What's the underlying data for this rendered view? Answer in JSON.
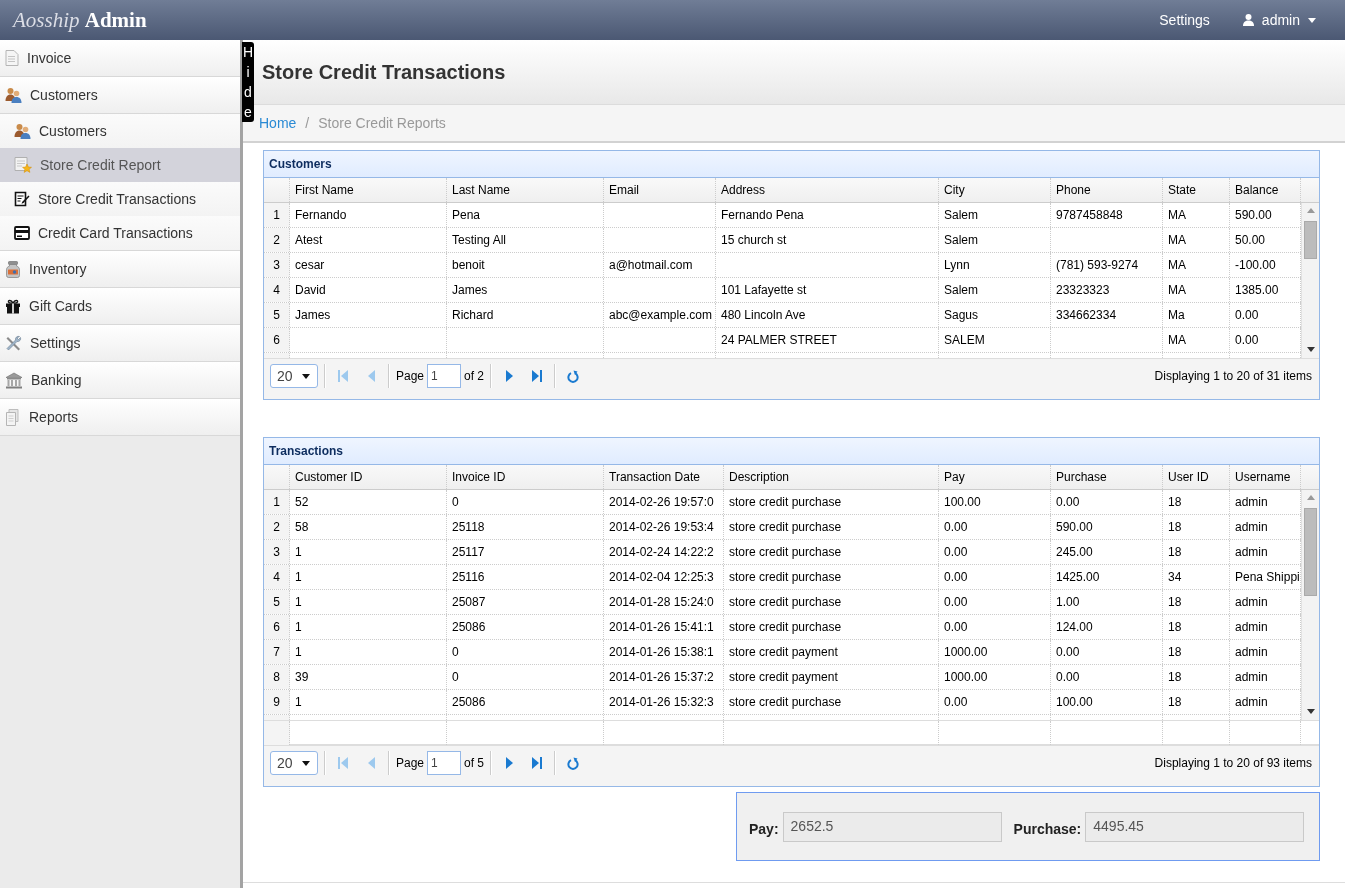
{
  "topbar": {
    "brand": {
      "primary": "Aosship",
      "secondary": "Admin"
    },
    "settings_link": "Settings",
    "user_menu": "admin"
  },
  "sidebar": {
    "items": [
      {
        "label": "Invoice",
        "selected": false
      },
      {
        "label": "Customers",
        "selected": false,
        "children": [
          {
            "label": "Customers",
            "selected": false
          },
          {
            "label": "Store Credit Report",
            "selected": true
          },
          {
            "label": "Store Credit Transactions",
            "selected": false
          },
          {
            "label": "Credit Card Transactions",
            "selected": false
          }
        ]
      },
      {
        "label": "Inventory",
        "selected": false
      },
      {
        "label": "Gift Cards",
        "selected": false
      },
      {
        "label": "Settings",
        "selected": false
      },
      {
        "label": "Banking",
        "selected": false
      },
      {
        "label": "Reports",
        "selected": false
      }
    ]
  },
  "hide_tab": "Hide",
  "page": {
    "title": "Store Credit Transactions",
    "breadcrumb": {
      "separator": "/",
      "items": [
        {
          "label": "Home",
          "kind": "link"
        },
        {
          "label": "Store Credit Reports",
          "kind": "current"
        }
      ]
    }
  },
  "customers_grid": {
    "title": "Customers",
    "columns": [
      "First Name",
      "Last Name",
      "Email",
      "Address",
      "City",
      "Phone",
      "State",
      "Balance"
    ],
    "rows": [
      {
        "number": "1",
        "cells": [
          "Fernando",
          "Pena",
          null,
          "Fernando Pena",
          "Salem",
          "9787458848",
          "MA",
          "590.00"
        ]
      },
      {
        "number": "2",
        "cells": [
          "Atest",
          "Testing All",
          null,
          "15 church st",
          "Salem",
          null,
          "MA",
          "50.00"
        ]
      },
      {
        "number": "3",
        "cells": [
          "cesar",
          "benoit",
          "a@hotmail.com",
          null,
          "Lynn",
          "(781) 593-9274",
          "MA",
          "-100.00"
        ]
      },
      {
        "number": "4",
        "cells": [
          "David",
          "James",
          null,
          "101 Lafayette st",
          "Salem",
          "23323323",
          "MA",
          "1385.00"
        ]
      },
      {
        "number": "5",
        "cells": [
          "James",
          "Richard",
          "abc@example.com",
          "480 Lincoln Ave",
          "Sagus",
          "334662334",
          "Ma",
          "0.00"
        ]
      },
      {
        "number": "6",
        "cells": [
          null,
          null,
          null,
          "24 PALMER STREET",
          "SALEM",
          null,
          "MA",
          "0.00"
        ]
      }
    ],
    "pager": {
      "page_size": "20",
      "page_label": "Page",
      "page": "1",
      "page_count": "of 2",
      "nav": [
        {
          "kind": "first",
          "disabled": true
        },
        {
          "kind": "prev",
          "disabled": true
        },
        {
          "kind": "next",
          "disabled": false
        },
        {
          "kind": "last",
          "disabled": false
        },
        {
          "kind": "refresh",
          "disabled": false
        }
      ],
      "summary": "Displaying 1 to 20 of 31 items"
    }
  },
  "transactions_grid": {
    "title": "Transactions",
    "columns": [
      "Customer ID",
      "Invoice ID",
      "Transaction Date",
      "Description",
      "Pay",
      "Purchase",
      "User ID",
      "Username"
    ],
    "rows": [
      {
        "number": "1",
        "cells": [
          "52",
          "0",
          "2014-02-26 19:57:0",
          "store credit purchase",
          "100.00",
          "0.00",
          "18",
          "admin"
        ]
      },
      {
        "number": "2",
        "cells": [
          "58",
          "25118",
          "2014-02-26 19:53:4",
          "store credit purchase",
          "0.00",
          "590.00",
          "18",
          "admin"
        ]
      },
      {
        "number": "3",
        "cells": [
          "1",
          "25117",
          "2014-02-24 14:22:2",
          "store credit purchase",
          "0.00",
          "245.00",
          "18",
          "admin"
        ]
      },
      {
        "number": "4",
        "cells": [
          "1",
          "25116",
          "2014-02-04 12:25:3",
          "store credit purchase",
          "0.00",
          "1425.00",
          "34",
          "Pena Shippi"
        ]
      },
      {
        "number": "5",
        "cells": [
          "1",
          "25087",
          "2014-01-28 15:24:0",
          "store credit purchase",
          "0.00",
          "1.00",
          "18",
          "admin"
        ]
      },
      {
        "number": "6",
        "cells": [
          "1",
          "25086",
          "2014-01-26 15:41:1",
          "store credit purchase",
          "0.00",
          "124.00",
          "18",
          "admin"
        ]
      },
      {
        "number": "7",
        "cells": [
          "1",
          "0",
          "2014-01-26 15:38:1",
          "store credit payment",
          "1000.00",
          "0.00",
          "18",
          "admin"
        ]
      },
      {
        "number": "8",
        "cells": [
          "39",
          "0",
          "2014-01-26 15:37:2",
          "store credit payment",
          "1000.00",
          "0.00",
          "18",
          "admin"
        ]
      },
      {
        "number": "9",
        "cells": [
          "1",
          "25086",
          "2014-01-26 15:32:3",
          "store credit purchase",
          "0.00",
          "100.00",
          "18",
          "admin"
        ]
      }
    ],
    "pager": {
      "page_size": "20",
      "page_label": "Page",
      "page": "1",
      "page_count": "of 5",
      "nav": [
        {
          "kind": "first",
          "disabled": true
        },
        {
          "kind": "prev",
          "disabled": true
        },
        {
          "kind": "next",
          "disabled": false
        },
        {
          "kind": "last",
          "disabled": false
        },
        {
          "kind": "refresh",
          "disabled": false
        }
      ],
      "summary": "Displaying 1 to 20 of 93 items"
    }
  },
  "totals": {
    "fields": [
      {
        "label": "Pay:",
        "value": "2652.5",
        "disabled": true
      },
      {
        "label": "Purchase:",
        "value": "4495.45",
        "disabled": true
      }
    ]
  }
}
